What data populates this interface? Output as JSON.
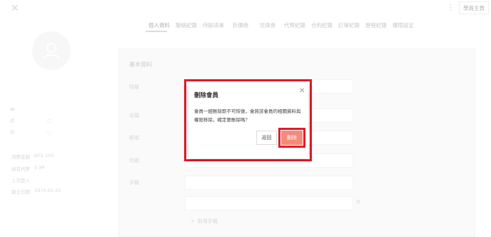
{
  "header": {
    "home_label": "學員主頁"
  },
  "tabs": [
    {
      "label": "個人資料"
    },
    {
      "label": "聯絡紀錄"
    },
    {
      "label": "待辦清單"
    },
    {
      "label": "折價券"
    },
    {
      "label": "兌換券"
    },
    {
      "label": "代幣紀錄"
    },
    {
      "label": "合約紀錄"
    },
    {
      "label": "訂單紀錄"
    },
    {
      "label": "歷程紀錄"
    },
    {
      "label": "權限設定"
    }
  ],
  "sidebar": {
    "stats": [
      {
        "label": "消費金額",
        "value": "NT$ 100"
      },
      {
        "label": "持有代幣",
        "value": "0 XP"
      },
      {
        "label": "上次登入",
        "value": ""
      },
      {
        "label": "建立日期",
        "value": "1970-01-01"
      }
    ]
  },
  "form": {
    "section_title": "基本資料",
    "labels": {
      "level": "階層",
      "name": "名稱",
      "account": "帳號",
      "email": "信箱",
      "phone": "手機"
    },
    "partial_value": "",
    "add_phone": "新增手機"
  },
  "modal": {
    "title": "刪除會員",
    "message": "會員一經刪除即不可恢復，會將該會員的相關資料與權限移除，確定要刪除嗎？",
    "back_label": "返回",
    "delete_label": "刪除"
  },
  "colors": {
    "accent": "#f58a7a",
    "highlight": "#e21b2b"
  }
}
